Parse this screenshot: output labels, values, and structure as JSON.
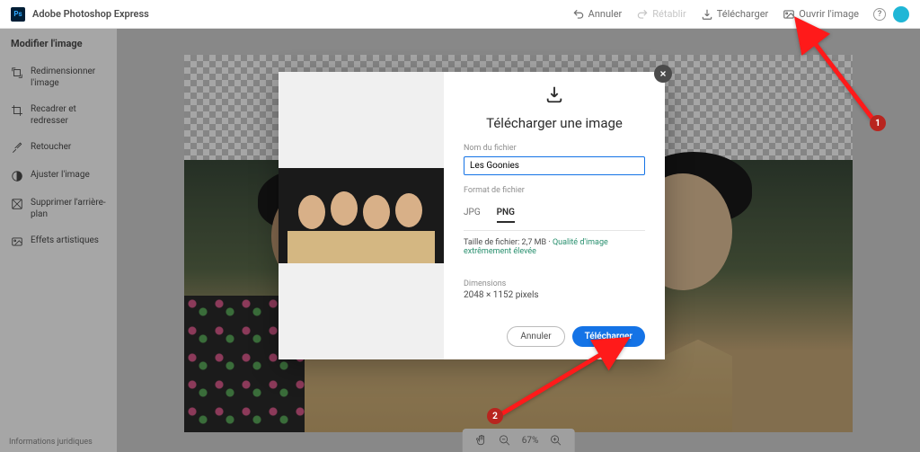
{
  "app": {
    "title": "Adobe Photoshop Express"
  },
  "topbar": {
    "undo": "Annuler",
    "redo": "Rétablir",
    "download": "Télécharger",
    "open": "Ouvrir l'image"
  },
  "sidebar": {
    "title": "Modifier l'image",
    "items": [
      {
        "label": "Redimensionner l'image"
      },
      {
        "label": "Recadrer et redresser"
      },
      {
        "label": "Retoucher"
      },
      {
        "label": "Ajuster l'image"
      },
      {
        "label": "Supprimer l'arrière-plan"
      },
      {
        "label": "Effets artistiques"
      }
    ],
    "legal": "Informations juridiques"
  },
  "zoombar": {
    "value": "67%"
  },
  "modal": {
    "title": "Télécharger une image",
    "filename_label": "Nom du fichier",
    "filename_value": "Les Goonies",
    "format_label": "Format de fichier",
    "format_jpg": "JPG",
    "format_png": "PNG",
    "filesize_label": "Taille de fichier:",
    "filesize_value": "2,7 MB",
    "quality": "Qualité d'image extrêmement élevée",
    "dimensions_label": "Dimensions",
    "dimensions_value": "2048 × 1152 pixels",
    "cancel": "Annuler",
    "confirm": "Télécharger"
  },
  "callouts": {
    "one": "1",
    "two": "2"
  }
}
